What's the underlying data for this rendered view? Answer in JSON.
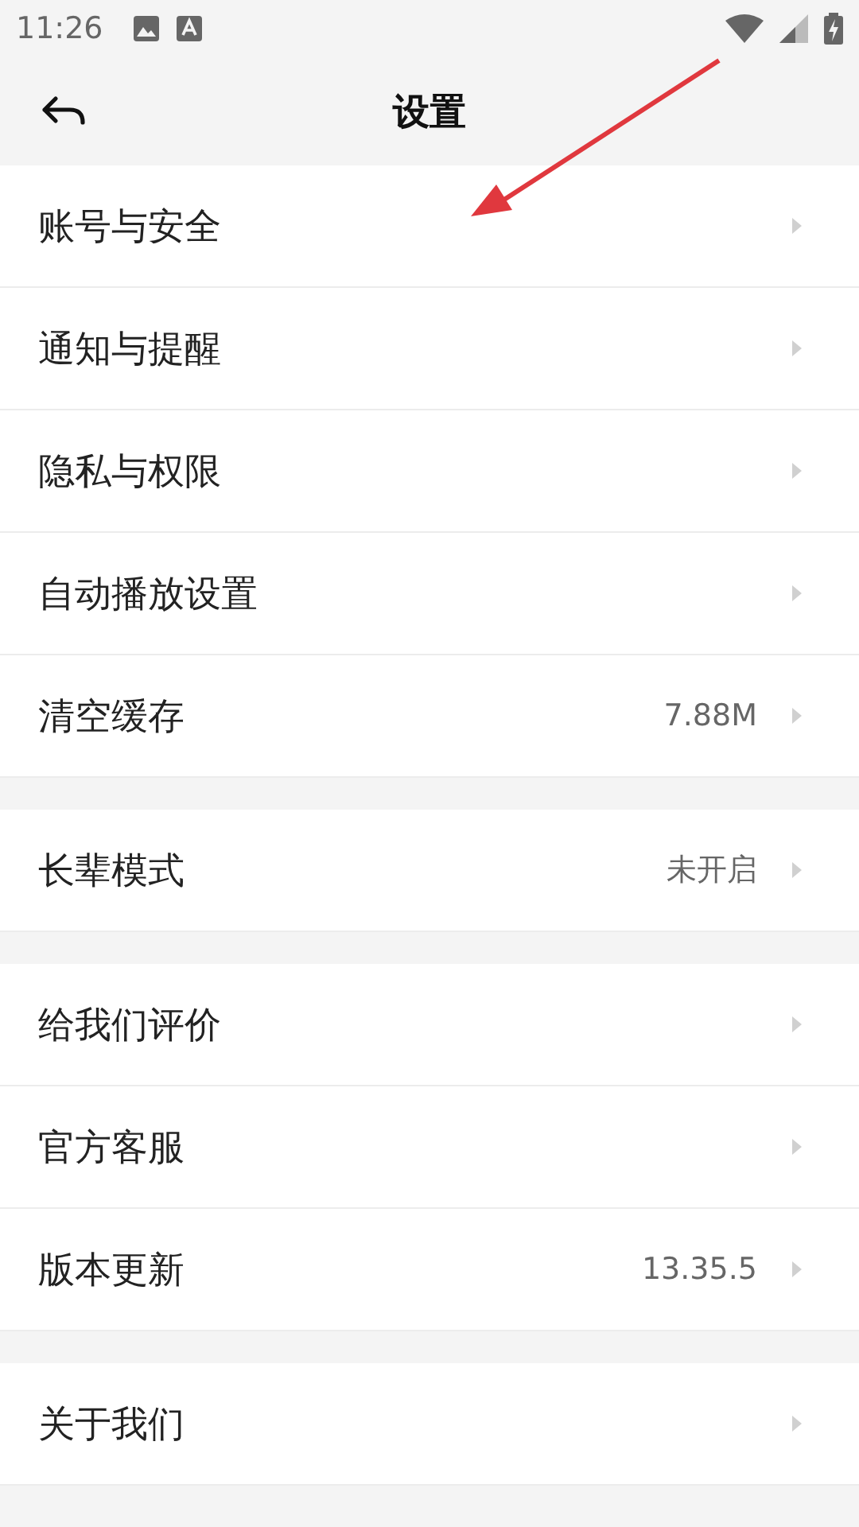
{
  "status_bar": {
    "time": "11:26"
  },
  "header": {
    "title": "设置"
  },
  "sections": [
    {
      "items": [
        {
          "label": "账号与安全"
        },
        {
          "label": "通知与提醒"
        },
        {
          "label": "隐私与权限"
        },
        {
          "label": "自动播放设置"
        },
        {
          "label": "清空缓存",
          "value": "7.88M"
        }
      ]
    },
    {
      "items": [
        {
          "label": "长辈模式",
          "value": "未开启"
        }
      ]
    },
    {
      "items": [
        {
          "label": "给我们评价"
        },
        {
          "label": "官方客服"
        },
        {
          "label": "版本更新",
          "value": "13.35.5"
        }
      ]
    },
    {
      "items": [
        {
          "label": "关于我们"
        }
      ]
    }
  ]
}
